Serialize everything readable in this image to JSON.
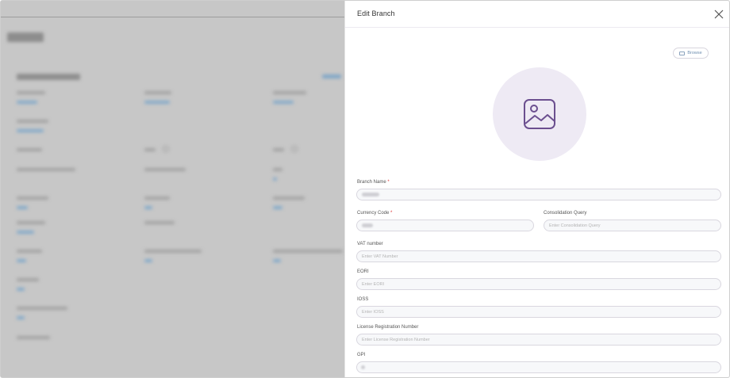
{
  "modal": {
    "title": "Edit Branch",
    "browse_label": "Browse"
  },
  "fields": {
    "branch_name": {
      "label": "Branch Name",
      "required_mark": "*",
      "value": ""
    },
    "currency_code": {
      "label": "Currency Code",
      "required_mark": "*",
      "value": ""
    },
    "consolidation_query": {
      "label": "Consolidation Query",
      "placeholder": "Enter Consolidation Query"
    },
    "vat_number": {
      "label": "VAT number",
      "placeholder": "Enter VAT Number"
    },
    "eori": {
      "label": "EORI",
      "placeholder": "Enter EORI"
    },
    "ioss": {
      "label": "IOSS",
      "placeholder": "Enter IOSS"
    },
    "license_registration_number": {
      "label": "License Registration Number",
      "placeholder": "Enter License Registration Number"
    },
    "gpi": {
      "label": "GPI",
      "value": ""
    }
  },
  "icons": {
    "close": "close-icon",
    "image_placeholder": "image-placeholder-icon",
    "browse": "image-icon"
  },
  "colors": {
    "accent": "#7b5ea7",
    "avatar_bg": "#eeeaf4",
    "link": "#6f8fb0"
  }
}
